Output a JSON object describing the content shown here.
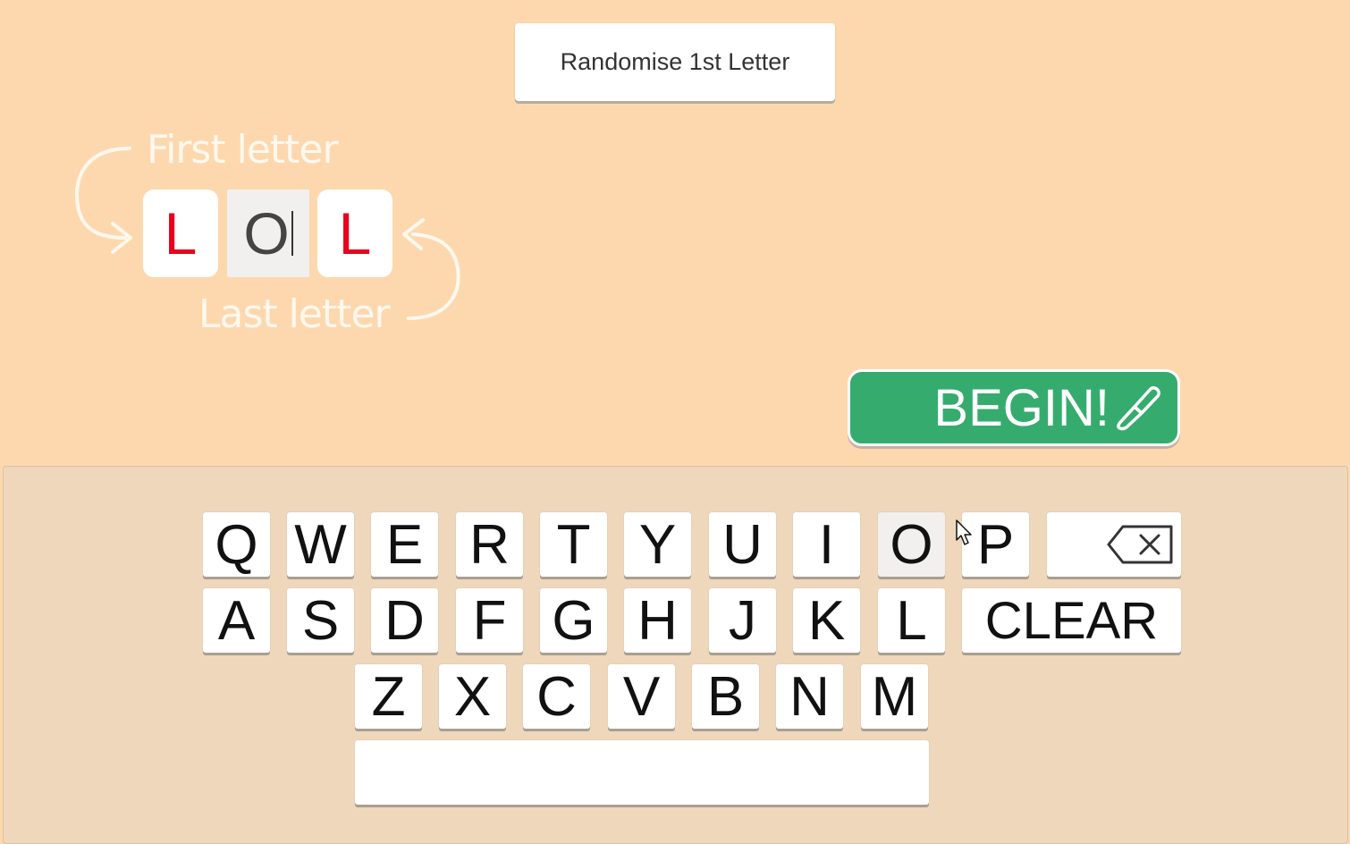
{
  "toolbar": {
    "randomise_label": "Randomise 1st Letter"
  },
  "hints": {
    "first_letter": "First letter",
    "last_letter": "Last letter"
  },
  "word": {
    "first": "L",
    "middle": "O",
    "last": "L"
  },
  "begin": {
    "label": "BEGIN!",
    "icon": "paintbrush-icon"
  },
  "keyboard": {
    "row1": [
      "Q",
      "W",
      "E",
      "R",
      "T",
      "Y",
      "U",
      "I",
      "O",
      "P"
    ],
    "row2": [
      "A",
      "S",
      "D",
      "F",
      "G",
      "H",
      "J",
      "K",
      "L"
    ],
    "row3": [
      "Z",
      "X",
      "C",
      "V",
      "B",
      "N",
      "M"
    ],
    "clear_label": "CLEAR",
    "backspace_icon": "backspace-icon",
    "space_label": ""
  },
  "colors": {
    "background": "#FDD8AF",
    "keyboard_panel": "#EFD7BB",
    "begin_button": "#35AC6E",
    "end_letters": "#E8001C"
  }
}
